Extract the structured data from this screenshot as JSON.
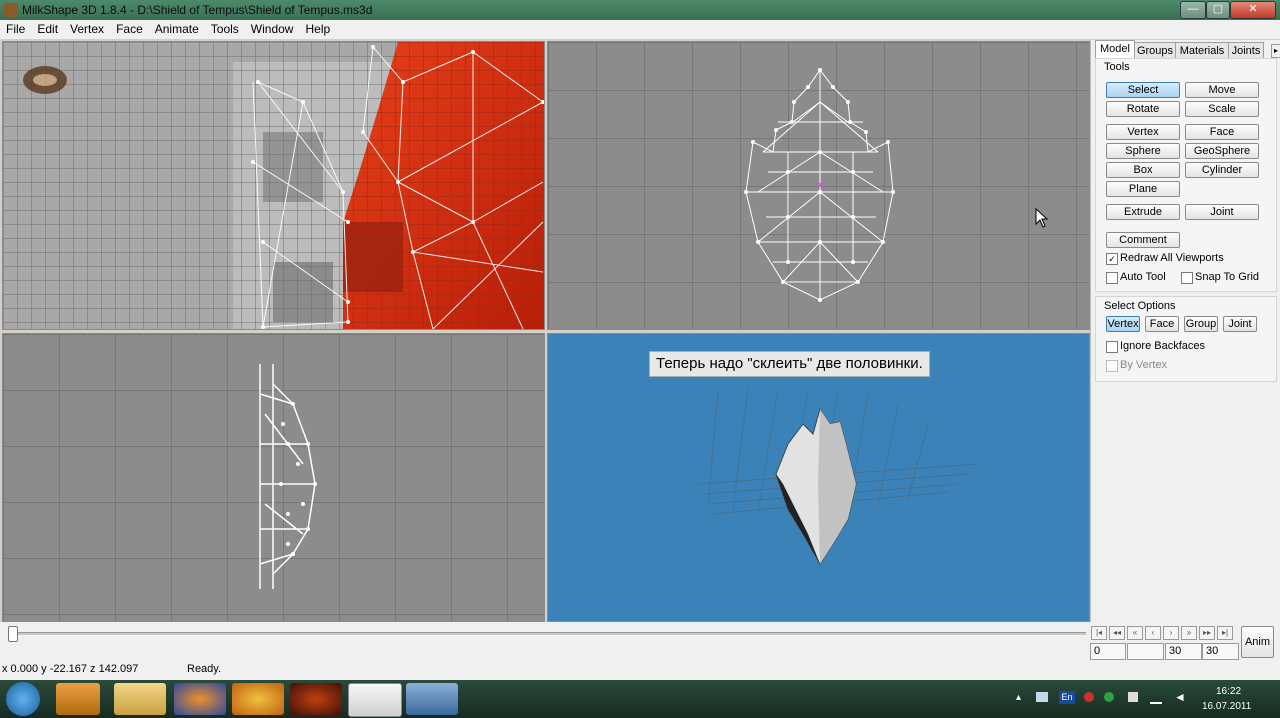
{
  "window": {
    "title": "MilkShape 3D 1.8.4 - D:\\Shield of Tempus\\Shield of Tempus.ms3d"
  },
  "menu": [
    "File",
    "Edit",
    "Vertex",
    "Face",
    "Animate",
    "Tools",
    "Window",
    "Help"
  ],
  "panel": {
    "tabs": [
      "Model",
      "Groups",
      "Materials",
      "Joints"
    ],
    "tools_title": "Tools",
    "buttons": {
      "select": "Select",
      "move": "Move",
      "rotate": "Rotate",
      "scale": "Scale",
      "vertex": "Vertex",
      "face": "Face",
      "sphere": "Sphere",
      "geosphere": "GeoSphere",
      "box": "Box",
      "cylinder": "Cylinder",
      "plane": "Plane",
      "extrude": "Extrude",
      "joint": "Joint",
      "comment": "Comment"
    },
    "checkboxes": {
      "redraw": "Redraw All Viewports",
      "autotool": "Auto Tool",
      "snap": "Snap To Grid"
    },
    "select_options_title": "Select Options",
    "select_options": [
      "Vertex",
      "Face",
      "Group",
      "Joint"
    ],
    "ignore_backfaces": "Ignore Backfaces",
    "by_vertex": "By Vertex"
  },
  "viewport3d": {
    "caption": "Теперь надо \"склеить\" две половинки."
  },
  "timeline": {
    "field_start": "0",
    "field_frame": "30",
    "field_end": "30",
    "anim_label": "Anim"
  },
  "status": {
    "coords": "x 0.000 y -22.167 z 142.097",
    "message": "Ready."
  },
  "tray": {
    "lang": "En",
    "time": "16:22",
    "date": "16.07.2011"
  }
}
